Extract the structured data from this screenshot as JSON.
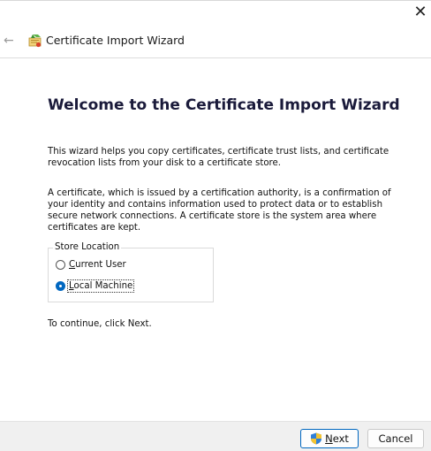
{
  "window": {
    "close_glyph": "✕",
    "back_glyph": "←",
    "title": "Certificate Import Wizard"
  },
  "main": {
    "heading": "Welcome to the Certificate Import Wizard",
    "paragraph1": "This wizard helps you copy certificates, certificate trust lists, and certificate revocation lists from your disk to a certificate store.",
    "paragraph2": "A certificate, which is issued by a certification authority, is a confirmation of your identity and contains information used to protect data or to establish secure network connections. A certificate store is the system area where certificates are kept.",
    "continue_text": "To continue, click Next."
  },
  "store_location": {
    "legend": "Store Location",
    "options": [
      {
        "label_mnemonic": "C",
        "label_rest": "urrent User",
        "selected": false
      },
      {
        "label_mnemonic": "L",
        "label_rest": "ocal Machine",
        "selected": true
      }
    ]
  },
  "footer": {
    "next_mnemonic": "N",
    "next_rest": "ext",
    "cancel_label": "Cancel"
  },
  "colors": {
    "accent": "#0067c0",
    "footer_bg": "#f0f0f0"
  },
  "icons": {
    "wizard": "certificate-wizard-icon",
    "shield": "uac-shield-icon"
  }
}
